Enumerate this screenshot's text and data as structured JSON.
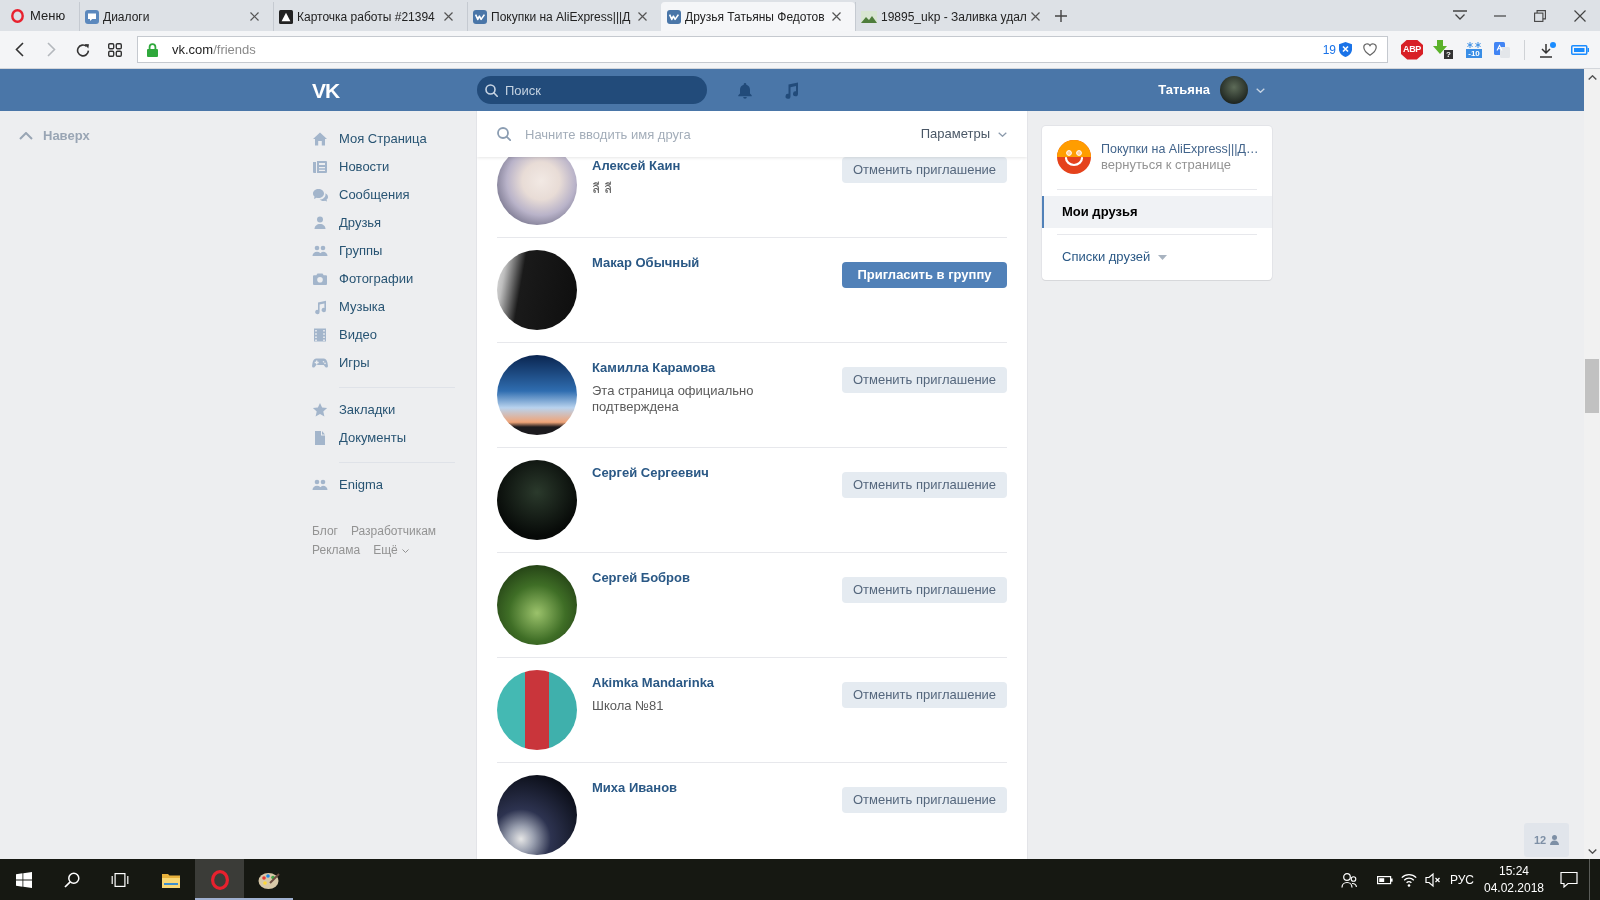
{
  "browser": {
    "menu_label": "Меню",
    "tabs": [
      {
        "kind": "chat",
        "label": "Диалоги",
        "selected": false
      },
      {
        "kind": "triangle",
        "label": "Карточка работы #21394",
        "selected": false
      },
      {
        "kind": "vk",
        "label": "Покупки на AliExpress|||Д",
        "selected": false
      },
      {
        "kind": "vk",
        "label": "Друзья Татьяны Федотов",
        "selected": true
      },
      {
        "kind": "image",
        "label": "19895_ukp - Заливка удал",
        "selected": false
      }
    ],
    "forward_disabled": true,
    "address": {
      "host": "vk.com",
      "path": "/friends"
    },
    "blocked_count": "19",
    "extensions": [
      {
        "kind": "adblock",
        "badge": "ABP"
      },
      {
        "kind": "downloader",
        "badge": "?"
      },
      {
        "kind": "weather",
        "badge": "-10"
      },
      {
        "kind": "translate"
      }
    ]
  },
  "vk": {
    "logo": "VK",
    "search_placeholder": "Поиск",
    "user_name": "Татьяна",
    "back_to_top": "Наверх",
    "menu_sections": [
      {
        "items": [
          {
            "kind": "home",
            "label": "Моя Страница"
          },
          {
            "kind": "news",
            "label": "Новости"
          },
          {
            "kind": "messages",
            "label": "Сообщения"
          },
          {
            "kind": "friends",
            "label": "Друзья"
          },
          {
            "kind": "groups",
            "label": "Группы"
          },
          {
            "kind": "photos",
            "label": "Фотографии"
          },
          {
            "kind": "music",
            "label": "Музыка"
          },
          {
            "kind": "video",
            "label": "Видео"
          },
          {
            "kind": "games",
            "label": "Игры"
          }
        ]
      },
      {
        "items": [
          {
            "kind": "bookmarks",
            "label": "Закладки"
          },
          {
            "kind": "documents",
            "label": "Документы"
          }
        ]
      },
      {
        "items": [
          {
            "kind": "community",
            "label": "Enigma"
          }
        ]
      }
    ],
    "footer_links": [
      {
        "label": "Блог",
        "dropdown": false
      },
      {
        "label": "Разработчикам",
        "dropdown": false
      },
      {
        "label": "Реклама",
        "dropdown": false
      },
      {
        "label": "Ещё",
        "dropdown": true
      }
    ],
    "friend_search": {
      "placeholder": "Начните вводить имя друга",
      "filter": "Параметры"
    },
    "friends": [
      {
        "name": "Алексей Каин",
        "subtitle": "ลี ลี",
        "action": {
          "kind": "cancel",
          "label": "Отменить приглашение"
        }
      },
      {
        "name": "Макар Обычный",
        "action": {
          "kind": "invite",
          "label": "Пригласить в группу"
        }
      },
      {
        "name": "Камилла Карамова",
        "subtitle": "Эта страница официально подтверждена",
        "action": {
          "kind": "cancel",
          "label": "Отменить приглашение"
        }
      },
      {
        "name": "Сергей Сергеевич",
        "action": {
          "kind": "cancel",
          "label": "Отменить приглашение"
        }
      },
      {
        "name": "Сергей Бобров",
        "action": {
          "kind": "cancel",
          "label": "Отменить приглашение"
        }
      },
      {
        "name": "Akimka Mandarinka",
        "subtitle": "Школа №81",
        "action": {
          "kind": "cancel",
          "label": "Отменить приглашение"
        }
      },
      {
        "name": "Миха Иванов",
        "action": {
          "kind": "cancel",
          "label": "Отменить приглашение"
        }
      }
    ],
    "side_panel": {
      "group": {
        "title": "Покупки на AliExpress|||Д…",
        "subtitle": "вернуться к странице"
      },
      "items": [
        {
          "label": "Мои друзья",
          "selected": true,
          "dropdown": false
        },
        {
          "label": "Списки друзей",
          "selected": false,
          "dropdown": true
        }
      ]
    },
    "online_count": "12"
  },
  "taskbar": {
    "apps": [
      {
        "kind": "explorer",
        "running": false,
        "selected": false
      },
      {
        "kind": "opera",
        "running": true,
        "selected": true
      },
      {
        "kind": "paint",
        "running": true,
        "selected": false
      }
    ],
    "language": "РУС",
    "time": "15:24",
    "date": "04.02.2018"
  }
}
